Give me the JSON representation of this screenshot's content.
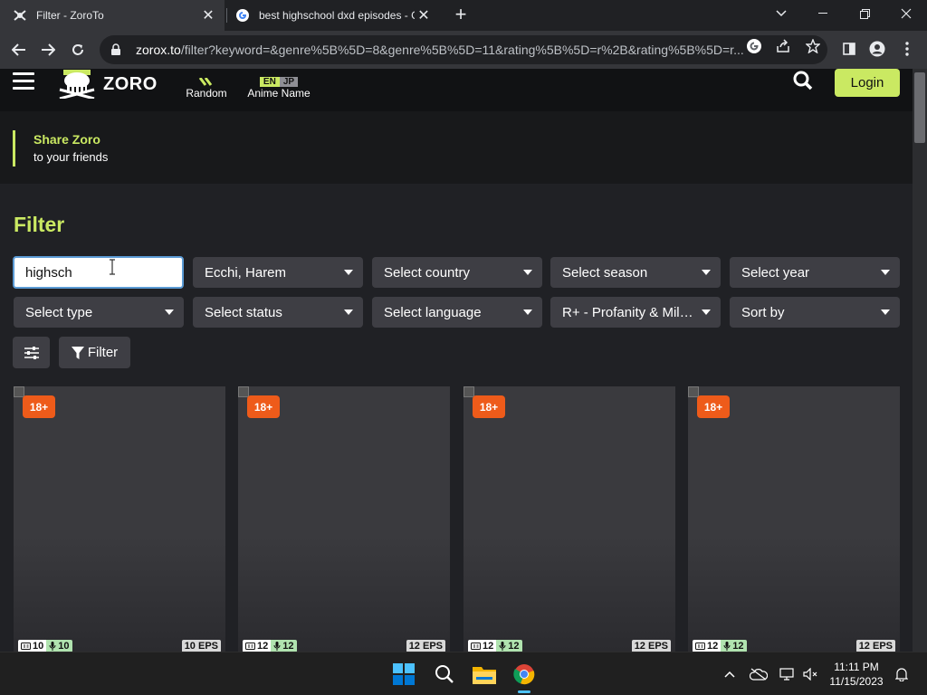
{
  "browser": {
    "tabs": [
      {
        "title": "Filter - ZoroTo",
        "active": true
      },
      {
        "title": "best highschool dxd episodes - G",
        "active": false
      }
    ],
    "url_host": "zorox.to",
    "url_rest": "/filter?keyword=&genre%5B%5D=8&genre%5B%5D=11&rating%5B%5D=r%2B&rating%5B%5D=r..."
  },
  "site": {
    "logo_text": "ZORO",
    "nav": {
      "random_label": "Random",
      "anime_name_label": "Anime Name",
      "lang_en": "EN",
      "lang_jp": "JP"
    },
    "login_label": "Login",
    "share": {
      "title": "Share Zoro",
      "subtitle": "to your friends"
    }
  },
  "filter": {
    "title": "Filter",
    "keyword_value": "highsch",
    "row1": [
      "Ecchi, Harem",
      "Select country",
      "Select season",
      "Select year"
    ],
    "row2": [
      "Select type",
      "Select status",
      "Select language",
      "R+ - Profanity & Mild ...",
      "Sort by"
    ],
    "filter_button_label": "Filter"
  },
  "cards": [
    {
      "rating": "18+",
      "sub": "10",
      "dub": "10",
      "eps": "10 EPS"
    },
    {
      "rating": "18+",
      "sub": "12",
      "dub": "12",
      "eps": "12 EPS"
    },
    {
      "rating": "18+",
      "sub": "12",
      "dub": "12",
      "eps": "12 EPS"
    },
    {
      "rating": "18+",
      "sub": "12",
      "dub": "12",
      "eps": "12 EPS"
    }
  ],
  "taskbar": {
    "time": "11:11 PM",
    "date": "11/15/2023"
  },
  "colors": {
    "accent": "#cae962",
    "badge": "#ee5b1a",
    "page_bg": "#202125"
  }
}
